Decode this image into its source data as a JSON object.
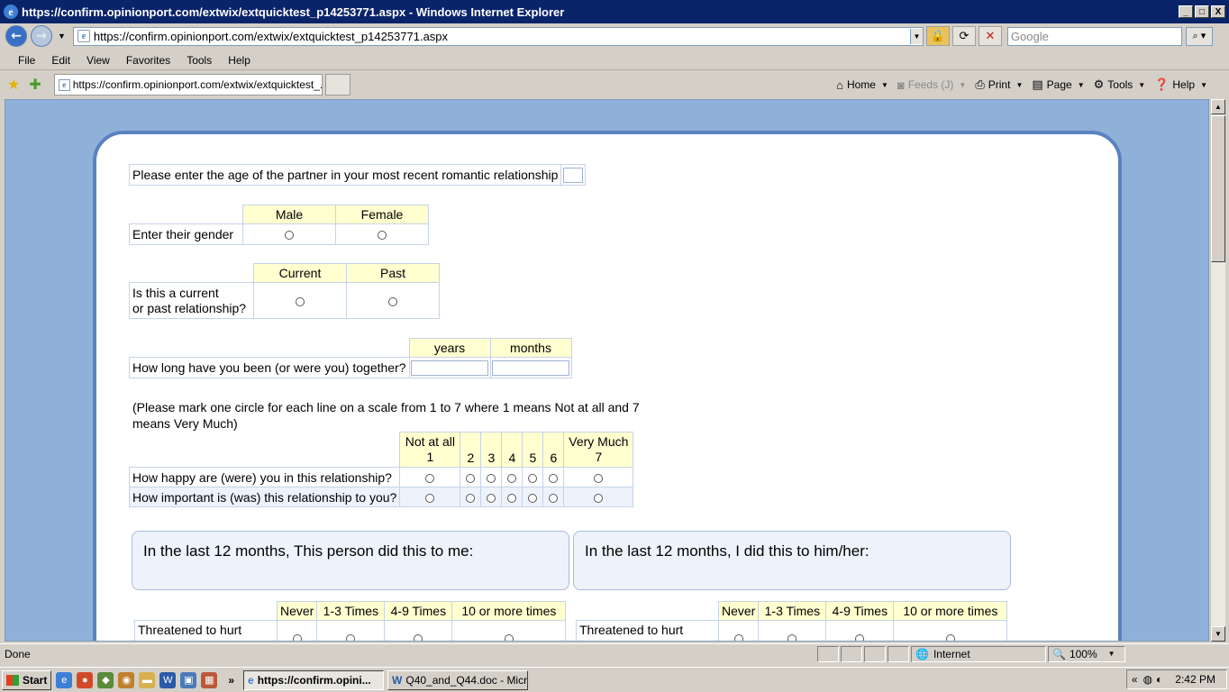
{
  "window": {
    "title": "https://confirm.opinionport.com/extwix/extquicktest_p14253771.aspx - Windows Internet Explorer",
    "min_label": "_",
    "max_label": "□",
    "close_label": "X"
  },
  "addressbar": {
    "url": "https://confirm.opinionport.com/extwix/extquicktest_p14253771.aspx",
    "search_placeholder": "Google"
  },
  "menu": [
    "File",
    "Edit",
    "View",
    "Favorites",
    "Tools",
    "Help"
  ],
  "tab": {
    "label": "https://confirm.opinionport.com/extwix/extquicktest_..."
  },
  "commands": {
    "home": "Home",
    "feeds": "Feeds (J)",
    "print": "Print",
    "page": "Page",
    "tools": "Tools",
    "help": "Help"
  },
  "form": {
    "age_question": "Please enter the age of the partner in your most recent romantic relationship",
    "gender": {
      "question": "Enter their gender",
      "options": [
        "Male",
        "Female"
      ]
    },
    "relationship": {
      "question_line1": "Is this a current",
      "question_line2": "or past relationship?",
      "options": [
        "Current",
        "Past"
      ]
    },
    "duration": {
      "question": "How long have you been (or were you) together?",
      "units": [
        "years",
        "months"
      ]
    },
    "instructions": "(Please mark one circle for each line on a scale from 1 to 7 where 1 means Not at all and 7 means Very Much)",
    "scale": {
      "low_label": "Not at all",
      "high_label": "Very Much",
      "points": [
        "1",
        "2",
        "3",
        "4",
        "5",
        "6",
        "7"
      ],
      "rows": [
        "How happy are (were) you in this relationship?",
        "How important is (was) this relationship to you?"
      ]
    },
    "panel_left": "In the last 12 months, This person did this to me:",
    "panel_right": "In the last 12 months, I did this to him/her:",
    "frequency": {
      "options": [
        "Never",
        "1-3 Times",
        "4-9 Times",
        "10 or more times"
      ],
      "first_item": "Threatened to hurt"
    }
  },
  "status": {
    "text": "Done",
    "zone": "Internet",
    "zoom": "100%"
  },
  "taskbar": {
    "start": "Start",
    "tasks": [
      "https://confirm.opini...",
      "Q40_and_Q44.doc - Micr..."
    ],
    "clock": "2:42 PM"
  }
}
